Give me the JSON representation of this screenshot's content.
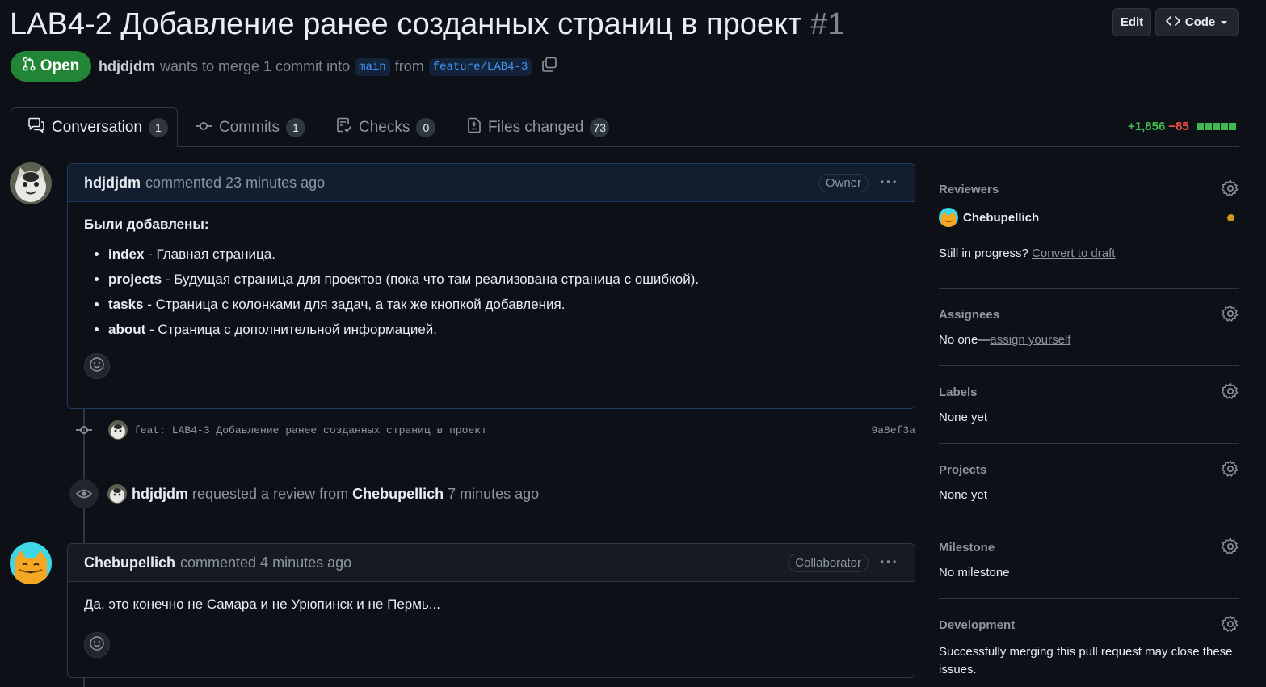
{
  "header": {
    "title": "LAB4-2 Добавление ранее созданных страниц в проект",
    "number": "#1",
    "edit_label": "Edit",
    "code_label": "Code",
    "state_label": "Open",
    "author": "hdjdjdm",
    "merge_text": "wants to merge 1 commit into",
    "base_branch": "main",
    "from_text": "from",
    "head_branch": "feature/LAB4-3"
  },
  "tabs": [
    {
      "label": "Conversation",
      "count": "1"
    },
    {
      "label": "Commits",
      "count": "1"
    },
    {
      "label": "Checks",
      "count": "0"
    },
    {
      "label": "Files changed",
      "count": "73"
    }
  ],
  "diffstat": {
    "additions": "+1,856",
    "deletions": "−85"
  },
  "comments": [
    {
      "author": "hdjdjdm",
      "meta": "commented 23 minutes ago",
      "role": "Owner",
      "heading": "Были добавлены:",
      "items": [
        {
          "term": "index",
          "desc": " - Главная страница."
        },
        {
          "term": "projects",
          "desc": " - Будущая страница для проектов (пока что там реализована страница с ошибкой)."
        },
        {
          "term": "tasks",
          "desc": " - Страница с колонками для задач, а так же кнопкой добавления."
        },
        {
          "term": "about",
          "desc": " - Страница с дополнительной информацией."
        }
      ]
    },
    {
      "author": "Chebupellich",
      "meta": "commented 4 minutes ago",
      "role": "Collaborator",
      "body": "Да, это конечно не Самара и не Урюпинск и не Пермь..."
    }
  ],
  "commit": {
    "message": "feat: LAB4-3 Добавление ранее созданных страниц в проект",
    "sha": "9a8ef3a"
  },
  "review_event": {
    "actor": "hdjdjdm",
    "text": "requested a review from",
    "reviewer": "Chebupellich",
    "time": "7 minutes ago"
  },
  "sidebar": {
    "reviewers": {
      "heading": "Reviewers",
      "name": "Chebupellich",
      "status_text": "Still in progress?",
      "convert_link": "Convert to draft"
    },
    "assignees": {
      "heading": "Assignees",
      "text": "No one—",
      "link": "assign yourself"
    },
    "labels": {
      "heading": "Labels",
      "text": "None yet"
    },
    "projects": {
      "heading": "Projects",
      "text": "None yet"
    },
    "milestone": {
      "heading": "Milestone",
      "text": "No milestone"
    },
    "development": {
      "heading": "Development",
      "text": "Successfully merging this pull request may close these issues."
    }
  },
  "colors": {
    "accent_green": "#238636",
    "pending_dot": "#d29922",
    "link_blue": "#4493f8"
  }
}
